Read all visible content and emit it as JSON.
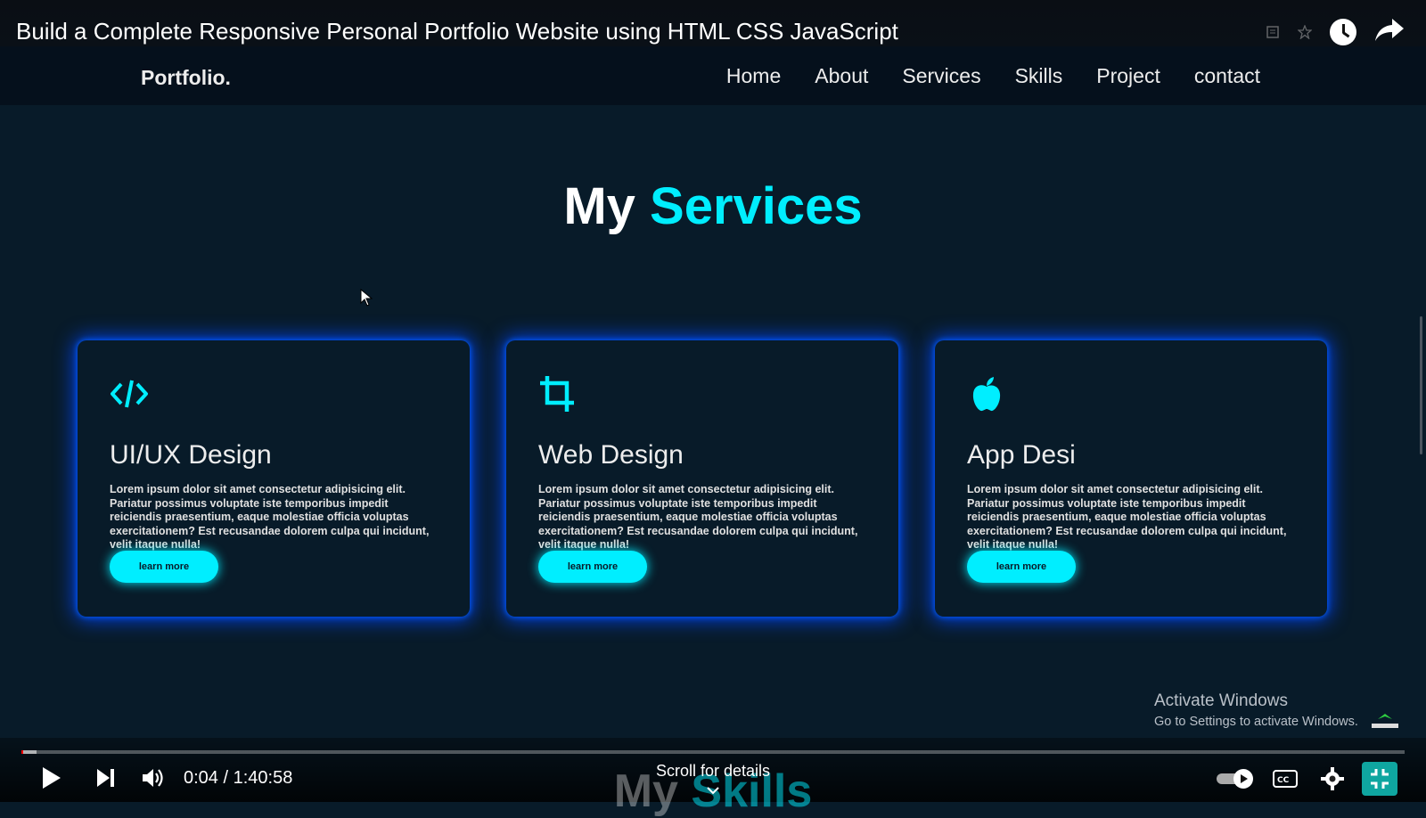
{
  "video": {
    "title": "Build a Complete Responsive Personal Portfolio Website using HTML CSS JavaScript"
  },
  "site": {
    "logo": "Portfolio.",
    "nav": [
      "Home",
      "About",
      "Services",
      "Skills",
      "Project",
      "contact"
    ]
  },
  "services": {
    "title_plain": "My",
    "title_accent": "Services",
    "cards": [
      {
        "icon": "code-icon",
        "title": "UI/UX Design",
        "text": "Lorem ipsum dolor sit amet consectetur adipisicing elit. Pariatur possimus voluptate iste temporibus impedit reiciendis praesentium, eaque molestiae officia voluptas exercitationem? Est recusandae dolorem culpa qui incidunt, velit itaque nulla!",
        "button": "learn more"
      },
      {
        "icon": "crop-icon",
        "title": "Web Design",
        "text": "Lorem ipsum dolor sit amet consectetur adipisicing elit. Pariatur possimus voluptate iste temporibus impedit reiciendis praesentium, eaque molestiae officia voluptas exercitationem? Est recusandae dolorem culpa qui incidunt, velit itaque nulla!",
        "button": "learn more"
      },
      {
        "icon": "apple-icon",
        "title": "App Desi",
        "text": "Lorem ipsum dolor sit amet consectetur adipisicing elit. Pariatur possimus voluptate iste temporibus impedit reiciendis praesentium, eaque molestiae officia voluptas exercitationem? Est recusandae dolorem culpa qui incidunt, velit itaque nulla!",
        "button": "learn more"
      }
    ]
  },
  "next_section": {
    "title_plain": "My",
    "title_accent": "Skills"
  },
  "windows_notice": {
    "line1": "Activate Windows",
    "line2": "Go to Settings to activate Windows."
  },
  "player": {
    "time": "0:04 / 1:40:58",
    "scroll_hint": "Scroll for details",
    "played_fraction": 0.0007,
    "buffered_fraction": 0.011
  },
  "colors": {
    "accent": "#00eeff",
    "background": "#081b29",
    "card_glow": "#0046ff",
    "progress_played": "#ff0000"
  }
}
